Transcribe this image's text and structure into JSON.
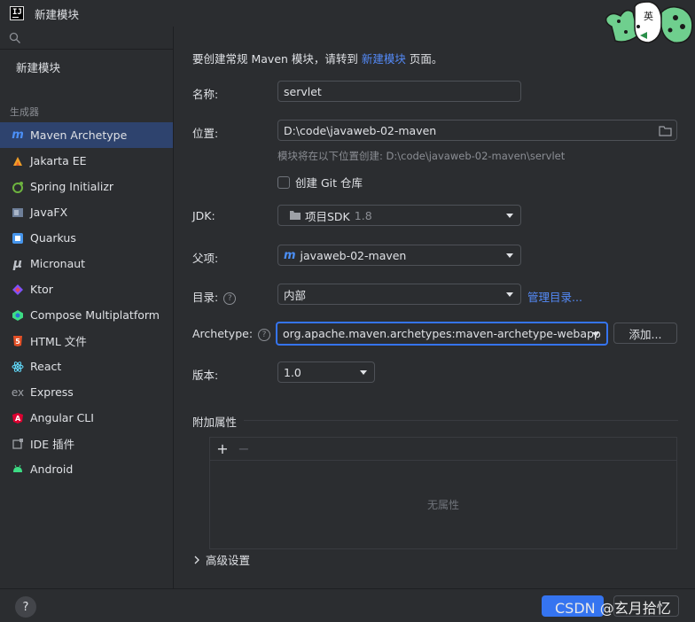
{
  "window": {
    "title": "新建模块"
  },
  "sidebar": {
    "search_placeholder": "",
    "new_module_label": "新建模块",
    "section_label": "生成器",
    "items": [
      {
        "label": "Maven Archetype",
        "icon": "maven-icon",
        "selected": true
      },
      {
        "label": "Jakarta EE",
        "icon": "jakarta-icon"
      },
      {
        "label": "Spring Initializr",
        "icon": "spring-icon"
      },
      {
        "label": "JavaFX",
        "icon": "javafx-icon"
      },
      {
        "label": "Quarkus",
        "icon": "quarkus-icon"
      },
      {
        "label": "Micronaut",
        "icon": "micronaut-icon"
      },
      {
        "label": "Ktor",
        "icon": "ktor-icon"
      },
      {
        "label": "Compose Multiplatform",
        "icon": "compose-icon"
      },
      {
        "label": "HTML 文件",
        "icon": "html5-icon"
      },
      {
        "label": "React",
        "icon": "react-icon"
      },
      {
        "label": "Express",
        "icon": "express-icon"
      },
      {
        "label": "Angular CLI",
        "icon": "angular-icon"
      },
      {
        "label": "IDE 插件",
        "icon": "plugin-icon"
      },
      {
        "label": "Android",
        "icon": "android-icon"
      }
    ]
  },
  "form": {
    "intro_prefix": "要创建常规 Maven 模块，请转到",
    "intro_link": "新建模块",
    "intro_suffix": "页面。",
    "name_label": "名称:",
    "name_value": "servlet",
    "location_label": "位置:",
    "location_value": "D:\\code\\javaweb-02-maven",
    "location_hint": "模块将在以下位置创建: D:\\code\\javaweb-02-maven\\servlet",
    "git_label": "创建 Git 仓库",
    "jdk_label": "JDK:",
    "jdk_value": "项目SDK",
    "jdk_version": "1.8",
    "parent_label": "父项:",
    "parent_value": "javaweb-02-maven",
    "catalog_label": "目录:",
    "catalog_value": "内部",
    "catalog_link": "管理目录...",
    "archetype_label": "Archetype:",
    "archetype_value": "org.apache.maven.archetypes:maven-archetype-webapp",
    "add_button": "添加...",
    "version_label": "版本:",
    "version_value": "1.0",
    "props_title": "附加属性",
    "props_empty": "无属性",
    "advanced_label": "高级设置"
  },
  "footer": {
    "help": "?",
    "watermark": "CSDN @玄月拾忆"
  },
  "colors": {
    "accent": "#3574f0",
    "selection": "#2e436e",
    "link": "#548af7"
  }
}
